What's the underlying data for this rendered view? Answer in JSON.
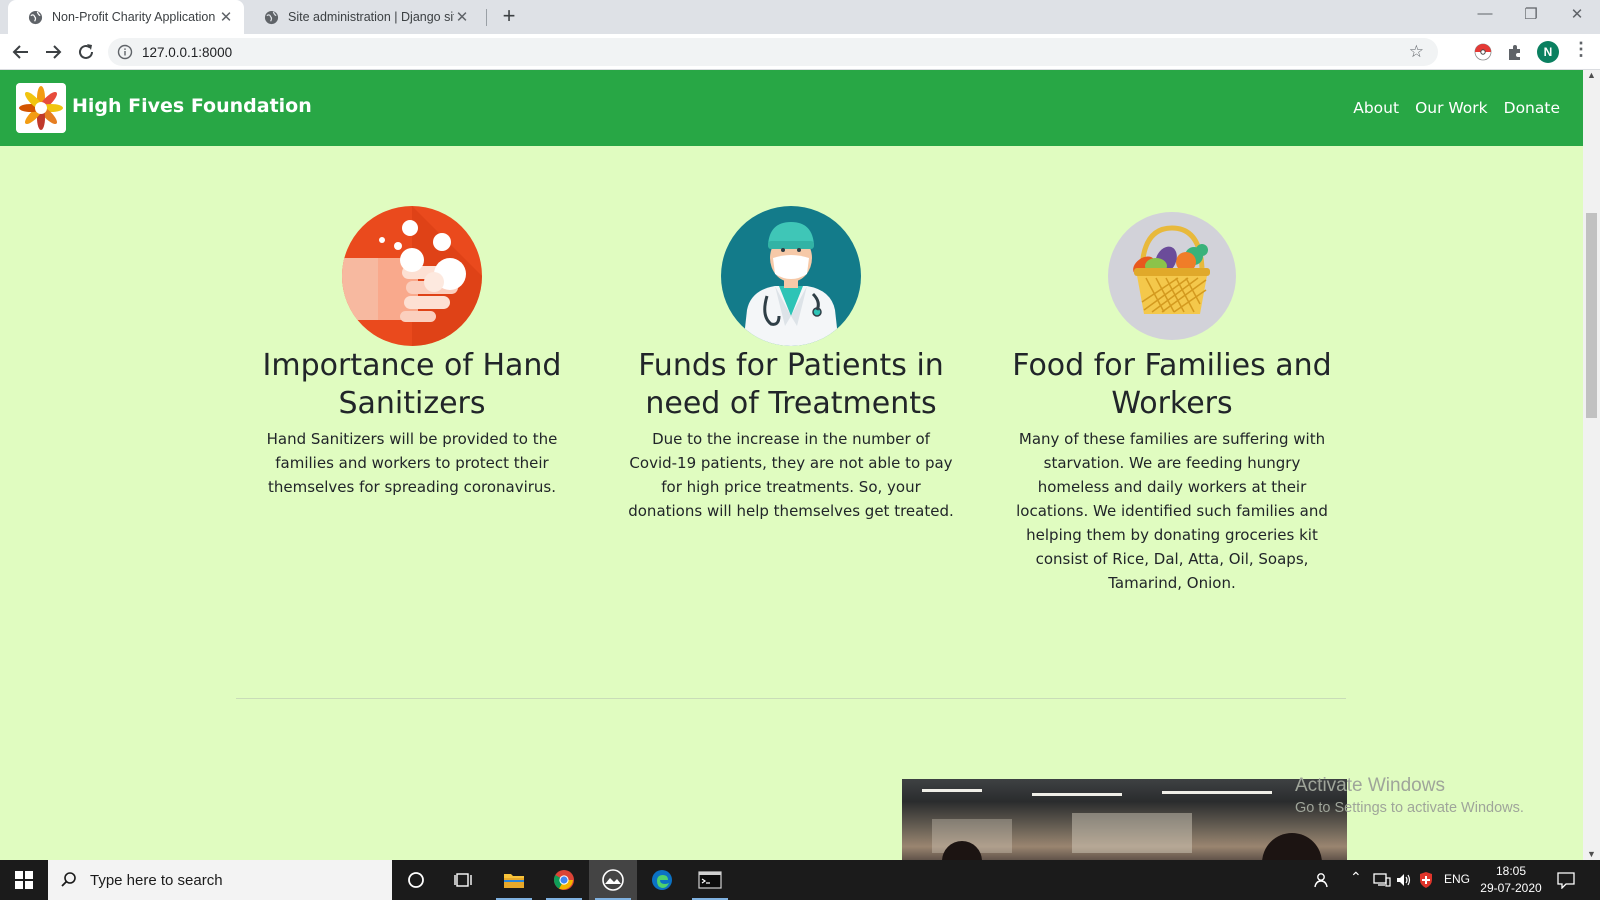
{
  "browser": {
    "tabs": [
      {
        "title": "Non-Profit Charity Application",
        "active": true
      },
      {
        "title": "Site administration | Django site",
        "active": false
      }
    ],
    "url": "127.0.0.1:8000",
    "profile_initial": "N"
  },
  "site": {
    "brand": "High Fives Foundation",
    "nav": [
      {
        "label": "About"
      },
      {
        "label": "Our Work"
      },
      {
        "label": "Donate"
      }
    ],
    "cards": [
      {
        "title": "Importance of Hand Sanitizers",
        "text": "Hand Sanitizers will be provided to the families and workers to protect their themselves for spreading coronavirus.",
        "icon": "hand-sanitizer-icon"
      },
      {
        "title": "Funds for Patients in need of Treatments",
        "text": "Due to the increase in the number of Covid-19 patients, they are not able to pay for high price treatments. So, your donations will help themselves get treated.",
        "icon": "doctor-icon"
      },
      {
        "title": "Food for Families and Workers",
        "text": "Many of these families are suffering with starvation. We are feeding hungry homeless and daily workers at their locations. We identified such families and helping them by donating groceries kit consist of Rice, Dal, Atta, Oil, Soaps, Tamarind, Onion.",
        "icon": "grocery-basket-icon"
      }
    ]
  },
  "watermark": {
    "line1": "Activate Windows",
    "line2": "Go to Settings to activate Windows."
  },
  "taskbar": {
    "search_placeholder": "Type here to search",
    "language": "ENG",
    "time": "18:05",
    "date": "29-07-2020"
  },
  "colors": {
    "navbar": "#28a745",
    "page_background": "#e0fcc0",
    "taskbar": "#1b1b1b"
  }
}
